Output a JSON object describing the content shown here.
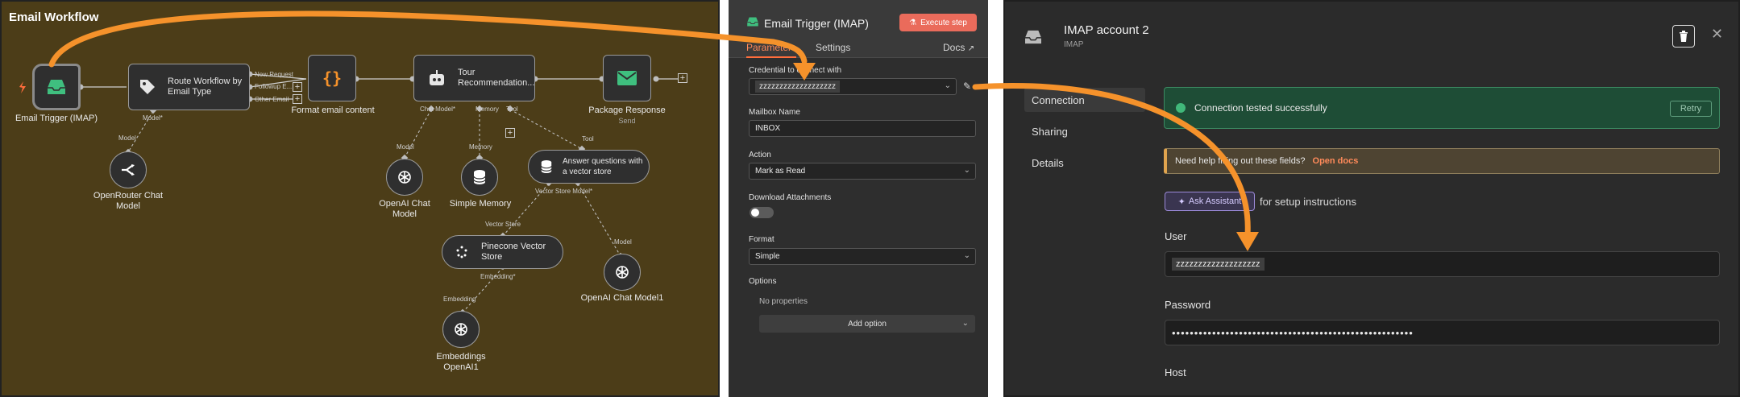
{
  "canvas": {
    "title": "Email Workflow",
    "nodes": {
      "email_trigger": "Email Trigger (IMAP)",
      "route": "Route Workflow by Email Type",
      "format": "Format email content",
      "tour": "Tour Recommendation...",
      "package": "Package Response",
      "package_sub": "Send",
      "openrouter": "OpenRouter Chat Model",
      "openai_chat": "OpenAI Chat Model",
      "simple_memory": "Simple Memory",
      "answer": "Answer questions with a vector store",
      "pinecone": "Pinecone Vector Store",
      "openai_chat1": "OpenAI Chat Model1",
      "embeddings": "Embeddings OpenAI1"
    },
    "ports": {
      "new_request": "New Request",
      "followup": "Followup E...",
      "other": "Other Email",
      "model_star": "Model*",
      "model": "Model",
      "chat_model_star": "Chat Model*",
      "memory": "Memory",
      "tool": "Tool",
      "vector_store_star": "Vector Store Model*",
      "vector_store": "Vector Store",
      "embedding_star": "Embedding*",
      "embedding": "Embedding"
    }
  },
  "params": {
    "title": "Email Trigger (IMAP)",
    "execute_label": "Execute step",
    "tabs": {
      "parameters": "Parameters",
      "settings": "Settings",
      "docs": "Docs"
    },
    "credential_label": "Credential to connect with",
    "credential_value": "zzzzzzzzzzzzzzzzzzz",
    "mailbox_label": "Mailbox Name",
    "mailbox_value": "INBOX",
    "action_label": "Action",
    "action_value": "Mark as Read",
    "download_label": "Download Attachments",
    "format_label": "Format",
    "format_value": "Simple",
    "options_label": "Options",
    "no_properties": "No properties",
    "add_option": "Add option"
  },
  "credential": {
    "title": "IMAP account 2",
    "subtitle": "IMAP",
    "nav": {
      "connection": "Connection",
      "sharing": "Sharing",
      "details": "Details"
    },
    "success_text": "Connection tested successfully",
    "retry_label": "Retry",
    "help_text": "Need help filling out these fields?",
    "help_link": "Open docs",
    "assistant_label": "Ask Assistant",
    "assistant_suffix": "for setup instructions",
    "user_label": "User",
    "user_value": "zzzzzzzzzzzzzzzzzzz",
    "password_label": "Password",
    "password_value": "••••••••••••••••••••••••••••••••••••••••••••••••••••••",
    "host_label": "Host"
  },
  "colors": {
    "canvas_bg": "#4c3d18",
    "accent_orange": "#f5922b",
    "execute_red": "#ea6b5b",
    "success_green": "#1e4d36",
    "trigger_green": "#3fbf7f"
  }
}
